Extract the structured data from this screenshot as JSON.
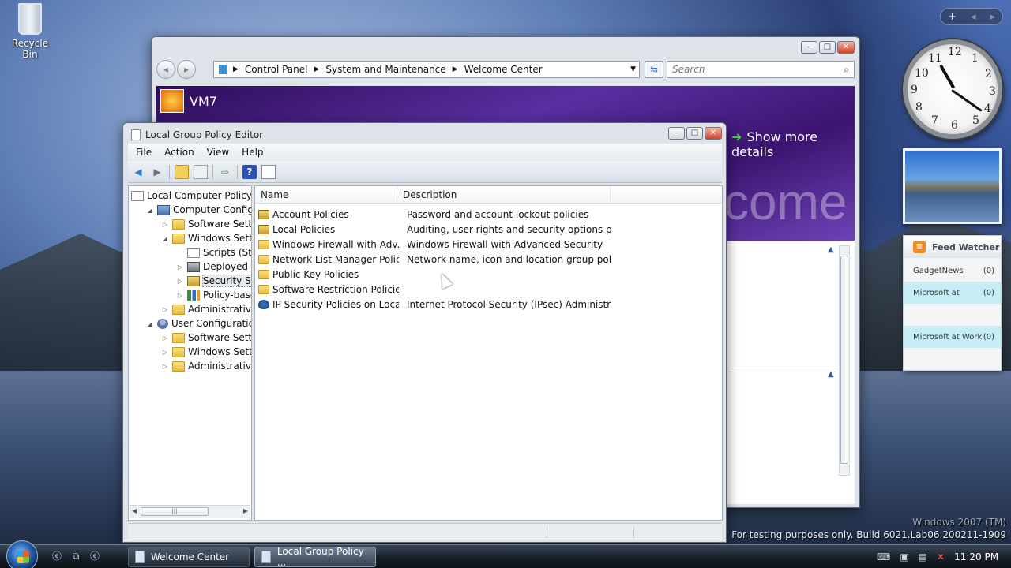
{
  "desktop": {
    "recycle_bin_label": "Recycle Bin",
    "watermark_os": "Windows 2007 (TM)",
    "watermark_build": "For testing purposes only. Build 6021.Lab06.200211-1909"
  },
  "gadgets": {
    "toolbar_icons": [
      "plus-icon",
      "left-arrow-icon",
      "right-arrow-icon"
    ],
    "clock": {
      "numbers": [
        "12",
        "1",
        "2",
        "3",
        "4",
        "5",
        "6",
        "7",
        "8",
        "9",
        "10",
        "11"
      ]
    },
    "feed_watcher": {
      "title": "Feed Watcher",
      "items": [
        {
          "name": "GadgetNews",
          "count": "(0)"
        },
        {
          "name": "Microsoft at",
          "count": "(0)"
        },
        {
          "name": "Microsoft at Work",
          "count": "(0)"
        }
      ]
    }
  },
  "welcome_center": {
    "breadcrumb": [
      "Control Panel",
      "System and Maintenance",
      "Welcome Center"
    ],
    "search_placeholder": "Search",
    "computer_name": "VM7",
    "show_more": "Show more details",
    "banner_text": "come"
  },
  "gpe": {
    "title": "Local Group Policy Editor",
    "menu": [
      "File",
      "Action",
      "View",
      "Help"
    ],
    "tree": [
      {
        "label": "Local Computer Policy",
        "icon": "policy",
        "indent": 0,
        "tw": ""
      },
      {
        "label": "Computer Configura",
        "icon": "computer",
        "indent": 1,
        "tw": "◢"
      },
      {
        "label": "Software Settings",
        "icon": "folder",
        "indent": 2,
        "tw": "▷"
      },
      {
        "label": "Windows Setting",
        "icon": "folder",
        "indent": 2,
        "tw": "◢"
      },
      {
        "label": "Scripts (Startu",
        "icon": "policy",
        "indent": 3,
        "tw": ""
      },
      {
        "label": "Deployed Prir",
        "icon": "printer",
        "indent": 3,
        "tw": "▷"
      },
      {
        "label": "Security Settir",
        "icon": "lock-folder",
        "indent": 3,
        "tw": "▷"
      },
      {
        "label": "Policy-based",
        "icon": "chart",
        "indent": 3,
        "tw": "▷"
      },
      {
        "label": "Administrative Te",
        "icon": "folder",
        "indent": 2,
        "tw": "▷"
      },
      {
        "label": "User Configuration",
        "icon": "user",
        "indent": 1,
        "tw": "◢"
      },
      {
        "label": "Software Settings",
        "icon": "folder",
        "indent": 2,
        "tw": "▷"
      },
      {
        "label": "Windows Setting",
        "icon": "folder",
        "indent": 2,
        "tw": "▷"
      },
      {
        "label": "Administrative Te",
        "icon": "folder",
        "indent": 2,
        "tw": "▷"
      }
    ],
    "columns": [
      "Name",
      "Description"
    ],
    "rows": [
      {
        "name": "Account Policies",
        "description": "Password and account lockout policies",
        "icon": "lock-folder"
      },
      {
        "name": "Local Policies",
        "description": "Auditing, user rights and security options polici...",
        "icon": "lock-folder"
      },
      {
        "name": "Windows Firewall with Adv...",
        "description": "Windows Firewall with Advanced Security",
        "icon": "folder"
      },
      {
        "name": "Network List Manager Polic...",
        "description": "Network name, icon and location group policies.",
        "icon": "folder"
      },
      {
        "name": "Public Key Policies",
        "description": "",
        "icon": "folder"
      },
      {
        "name": "Software Restriction Policies",
        "description": "",
        "icon": "folder"
      },
      {
        "name": "IP Security Policies on Local...",
        "description": "Internet Protocol Security (IPsec) Administratio...",
        "icon": "shield"
      }
    ]
  },
  "taskbar": {
    "tasks": [
      {
        "label": "Welcome Center",
        "active": false
      },
      {
        "label": "Local Group Policy ...",
        "active": true
      }
    ],
    "time": "11:20 PM"
  }
}
